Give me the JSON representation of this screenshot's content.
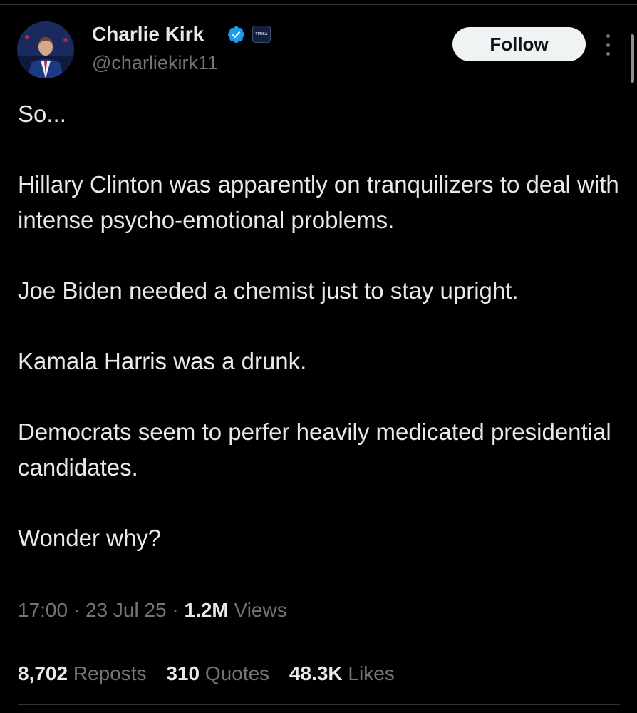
{
  "author": {
    "display_name": "Charlie Kirk",
    "handle": "@charliekirk11",
    "verified_badge_color": "#1d9bf0",
    "affiliate_badge_text": "TPUSA"
  },
  "follow_button": {
    "label": "Follow"
  },
  "tweet": {
    "paragraphs": [
      "So...",
      "Hillary Clinton was apparently on tranquilizers to deal with intense psycho-emotional problems.",
      "Joe Biden needed a chemist just to stay upright.",
      "Kamala Harris was a drunk.",
      "Democrats seem to perfer heavily medicated presidential candidates.",
      "Wonder why?"
    ]
  },
  "meta": {
    "time": "17:00",
    "separator": "·",
    "date": "23 Jul 25",
    "views_count": "1.2M",
    "views_label": "Views"
  },
  "stats": {
    "reposts_count": "8,702",
    "reposts_label": "Reposts",
    "quotes_count": "310",
    "quotes_label": "Quotes",
    "likes_count": "48.3K",
    "likes_label": "Likes"
  },
  "colors": {
    "background": "#000000",
    "text_primary": "#e7e9ea",
    "text_secondary": "#71767b",
    "divider": "#2f3336",
    "button_bg": "#eff3f4"
  }
}
